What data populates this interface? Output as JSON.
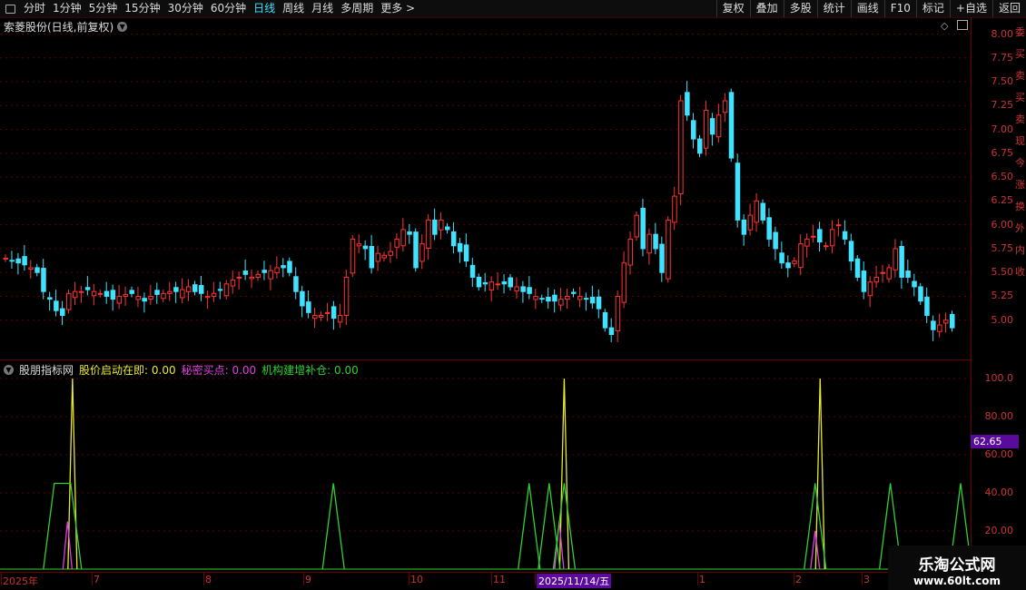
{
  "toolbar": {
    "periods": [
      "分时",
      "1分钟",
      "5分钟",
      "15分钟",
      "30分钟",
      "60分钟",
      "日线",
      "周线",
      "月线",
      "多周期",
      "更多 >"
    ],
    "active_period": "日线",
    "right_buttons": [
      "复权",
      "叠加",
      "多股",
      "统计",
      "画线",
      "F10",
      "标记",
      "+自选",
      "返回"
    ]
  },
  "main_title": "索菱股份(日线,前复权)",
  "indicator": {
    "name": "股朋指标网",
    "series": [
      {
        "label": "股价启动在即: 0.00",
        "color": "#e8e830"
      },
      {
        "label": "秘密买点: 0.00",
        "color": "#e040e0"
      },
      {
        "label": "机构建增补仓: 0.00",
        "color": "#30d030"
      }
    ],
    "current_value": "62.65"
  },
  "price_axis": [
    "8.00",
    "7.75",
    "7.50",
    "7.25",
    "7.00",
    "6.75",
    "6.50",
    "6.25",
    "6.00",
    "5.75",
    "5.50",
    "5.25",
    "5.00"
  ],
  "indicator_axis": [
    "100.0",
    "80.00",
    "60.00",
    "40.00",
    "20.00"
  ],
  "side_strip": [
    "委",
    "买",
    "卖",
    "买",
    "卖",
    "现",
    "今",
    "涨",
    "换",
    "外",
    "内",
    "收"
  ],
  "x_labels": [
    "2025年",
    "7",
    "8",
    "9",
    "10",
    "11",
    "2025/11/14/五",
    "1",
    "2",
    "3"
  ],
  "watermark": {
    "line1": "乐淘公式网",
    "line2": "www.60lt.com"
  },
  "colors": {
    "up": "#ff3232",
    "down": "#3fe3ff",
    "axis": "#c33"
  },
  "chart_data": {
    "type": "candlestick",
    "title": "索菱股份(日线,前复权)",
    "ylim": [
      4.75,
      8.1
    ],
    "closes": [
      5.65,
      5.62,
      5.6,
      5.58,
      5.55,
      5.5,
      5.3,
      5.22,
      5.1,
      5.05,
      5.28,
      5.3,
      5.3,
      5.32,
      5.3,
      5.28,
      5.25,
      5.22,
      5.25,
      5.27,
      5.28,
      5.25,
      5.2,
      5.25,
      5.27,
      5.28,
      5.3,
      5.3,
      5.32,
      5.35,
      5.3,
      5.28,
      5.25,
      5.28,
      5.32,
      5.38,
      5.42,
      5.45,
      5.48,
      5.45,
      5.48,
      5.5,
      5.52,
      5.55,
      5.55,
      5.5,
      5.3,
      5.15,
      5.08,
      5.05,
      5.05,
      5.08,
      5.02,
      5.05,
      5.45,
      5.85,
      5.8,
      5.75,
      5.55,
      5.7,
      5.68,
      5.72,
      5.85,
      5.95,
      5.9,
      5.55,
      5.8,
      6.05,
      5.9,
      6.05,
      5.95,
      5.78,
      5.72,
      5.62,
      5.45,
      5.35,
      5.38,
      5.4,
      5.38,
      5.38,
      5.35,
      5.35,
      5.3,
      5.28,
      5.25,
      5.22,
      5.2,
      5.2,
      5.22,
      5.25,
      5.28,
      5.25,
      5.22,
      5.18,
      5.12,
      4.92,
      4.85,
      5.25,
      5.6,
      5.85,
      6.1,
      5.75,
      5.9,
      5.75,
      5.5,
      6.05,
      6.3,
      7.3,
      7.15,
      6.9,
      6.75,
      7.2,
      6.95,
      7.15,
      7.3,
      6.7,
      6.05,
      5.9,
      6.1,
      6.25,
      6.05,
      5.85,
      5.75,
      5.6,
      5.55,
      5.62,
      5.8,
      5.85,
      5.88,
      5.82,
      5.78,
      5.95,
      6.0,
      5.85,
      5.62,
      5.45,
      5.3,
      5.4,
      5.45,
      5.5,
      5.55,
      5.75,
      5.45,
      5.45,
      5.35,
      5.2,
      5.05,
      4.9,
      4.95,
      5.0,
      4.92
    ],
    "indicator_series": {
      "股价启动在即": {
        "peaks": [
          {
            "x_index": 13,
            "value": 100
          },
          {
            "x_index": 111,
            "value": 100
          },
          {
            "x_index": 162,
            "value": 100
          }
        ]
      },
      "秘密买点": {
        "peaks": [
          {
            "x_index": 12,
            "value": 25
          },
          {
            "x_index": 110,
            "value": 25
          },
          {
            "x_index": 161,
            "value": 20
          }
        ]
      },
      "机构建增补仓": {
        "peaks": [
          {
            "x_index": 11,
            "value": 45
          },
          {
            "x_index": 65,
            "value": 45
          },
          {
            "x_index": 104,
            "value": 45
          },
          {
            "x_index": 108,
            "value": 45
          },
          {
            "x_index": 111,
            "value": 45
          },
          {
            "x_index": 161,
            "value": 45
          },
          {
            "x_index": 176,
            "value": 45
          },
          {
            "x_index": 190,
            "value": 45
          }
        ]
      }
    }
  }
}
